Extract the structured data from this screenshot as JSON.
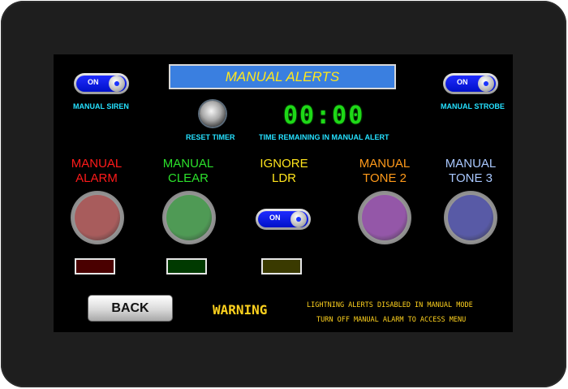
{
  "header": {
    "title": "MANUAL ALERTS"
  },
  "manual_siren": {
    "toggle_text": "ON",
    "label": "MANUAL SIREN"
  },
  "manual_strobe": {
    "toggle_text": "ON",
    "label": "MANUAL STROBE"
  },
  "reset_timer": {
    "label": "RESET TIMER"
  },
  "timer": {
    "value": "00:00",
    "label": "TIME REMAINING IN MANUAL ALERT"
  },
  "buttons": [
    {
      "label_line1": "MANUAL",
      "label_line2": "ALARM",
      "label_color": "#ff1a1a",
      "cap_color": "#a85c5c"
    },
    {
      "label_line1": "MANUAL",
      "label_line2": "CLEAR",
      "label_color": "#2be02b",
      "cap_color": "#4f9a55"
    },
    {
      "label_line1": "MANUAL",
      "label_line2": "TONE 2",
      "label_color": "#ff9a1a",
      "cap_color": "#9457a8"
    },
    {
      "label_line1": "MANUAL",
      "label_line2": "TONE 3",
      "label_color": "#a9c8ff",
      "cap_color": "#585aa6"
    }
  ],
  "ignore_ldr": {
    "label_line1": "IGNORE",
    "label_line2": "LDR",
    "label_color": "#ffe41c",
    "toggle_text": "ON"
  },
  "indicators": {
    "alarm_color": "#4a0000",
    "clear_color": "#003a00",
    "ldr_color": "#3a3a00"
  },
  "back_button": {
    "label": "BACK"
  },
  "warning": {
    "title": "WARNING",
    "line1": "LIGHTNING ALERTS DISABLED IN MANUAL MODE",
    "line2": "TURN OFF MANUAL ALARM TO ACCESS MENU"
  }
}
